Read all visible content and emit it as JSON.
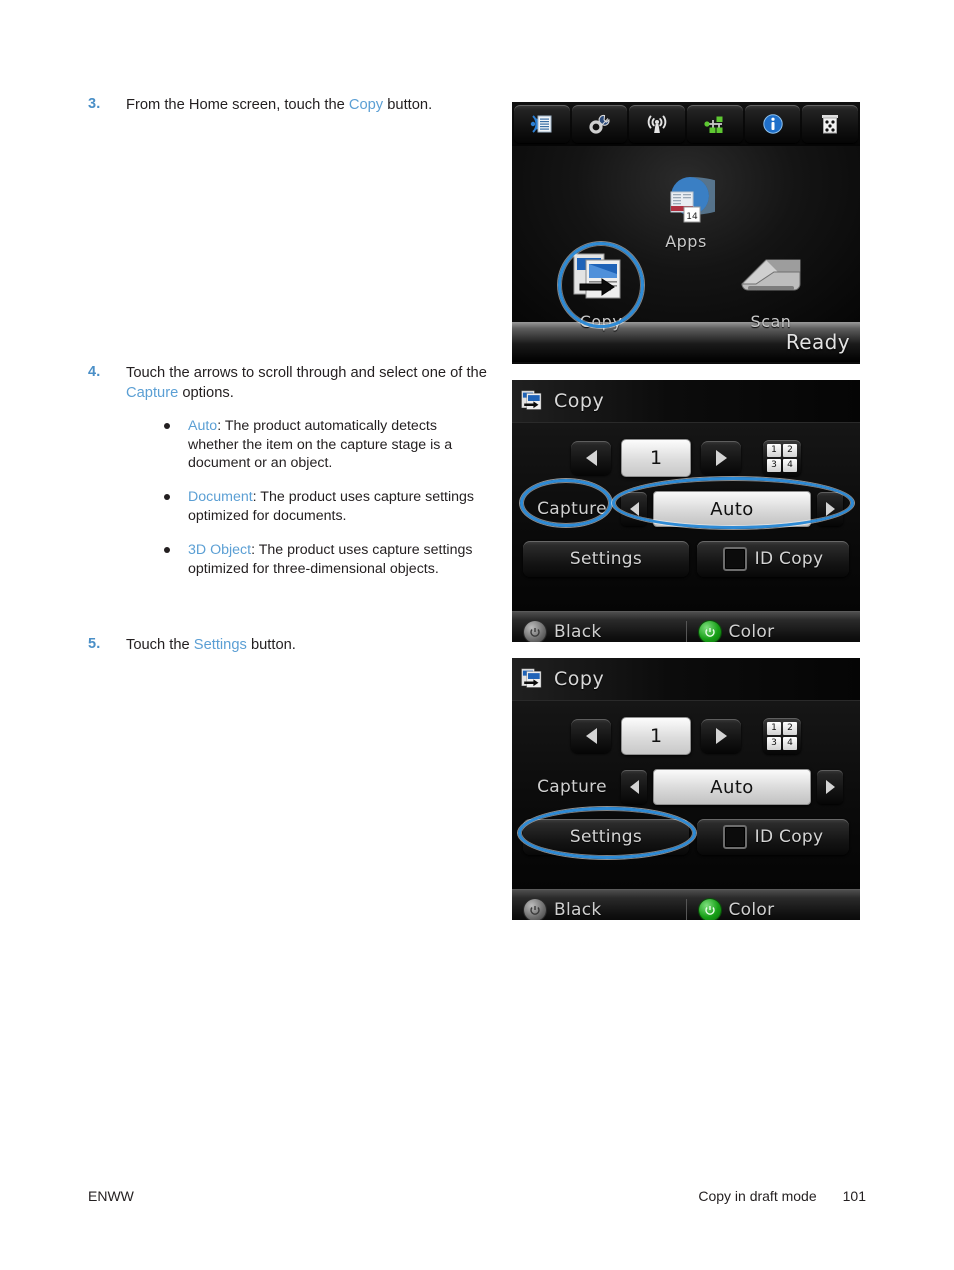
{
  "document": {
    "footer": {
      "left": "ENWW",
      "section": "Copy in draft mode",
      "page_number": "101"
    },
    "link_color": "#5b9fd4",
    "step_number_color": "#4a8fc7",
    "highlight_color": "#2e8bd6"
  },
  "steps": [
    {
      "number": "3.",
      "text_before": "From the Home screen, touch the ",
      "link": "Copy",
      "text_after": " button."
    },
    {
      "number": "4.",
      "text_before": "Touch the arrows to scroll through and select one of the ",
      "link": "Capture",
      "text_after": " options.",
      "bullets": [
        {
          "term": "Auto",
          "desc": ": The product automatically detects whether the item on the capture stage is a document or an object."
        },
        {
          "term": "Document",
          "desc": ": The product uses capture settings optimized for documents."
        },
        {
          "term": "3D Object",
          "desc": ": The product uses capture settings optimized for three-dimensional objects."
        }
      ]
    },
    {
      "number": "5.",
      "text_before": "Touch the ",
      "link": "Settings",
      "text_after": " button."
    }
  ],
  "screens": {
    "home": {
      "toolbar_icons": [
        "web-services-icon",
        "setup-wrench-gear-icon",
        "wireless-signal-icon",
        "network-icon",
        "information-icon",
        "supplies-ink-level-icon"
      ],
      "apps_label": "Apps",
      "apps_icon": "apps-globe-icon",
      "tiles": [
        {
          "label": "Copy",
          "icon": "copy-icon",
          "highlighted": true
        },
        {
          "label": "Scan",
          "icon": "scanner-icon",
          "highlighted": false
        }
      ],
      "status": "Ready"
    },
    "copy_capture": {
      "title": "Copy",
      "title_icon": "copy-icon",
      "copy_count": "1",
      "collate_icon_cells": [
        "1",
        "2",
        "3",
        "4"
      ],
      "capture_label": "Capture",
      "capture_value": "Auto",
      "settings_label": "Settings",
      "id_copy_label": "ID Copy",
      "black_label": "Black",
      "color_label": "Color",
      "highlight": [
        "capture-label",
        "capture-value-selector"
      ]
    },
    "copy_settings": {
      "title": "Copy",
      "title_icon": "copy-icon",
      "copy_count": "1",
      "collate_icon_cells": [
        "1",
        "2",
        "3",
        "4"
      ],
      "capture_label": "Capture",
      "capture_value": "Auto",
      "settings_label": "Settings",
      "id_copy_label": "ID Copy",
      "black_label": "Black",
      "color_label": "Color",
      "highlight": [
        "settings-button"
      ]
    }
  }
}
